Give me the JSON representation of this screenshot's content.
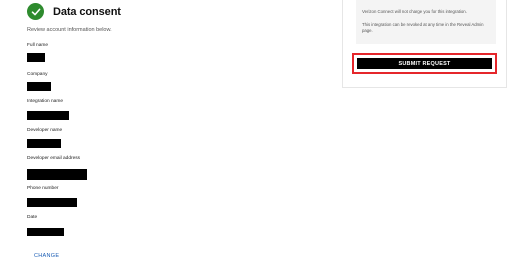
{
  "header": {
    "title": "Data consent",
    "check_icon": "check-circle-icon",
    "accent_color": "#2e8b2e"
  },
  "subtitle": "Review account information below.",
  "fields": [
    {
      "label": "Full name",
      "value_redacted": true
    },
    {
      "label": "Company",
      "value_redacted": true
    },
    {
      "label": "Integration name",
      "value_redacted": true
    },
    {
      "label": "Developer name",
      "value_redacted": true
    },
    {
      "label": "Developer email address",
      "value_redacted": true
    },
    {
      "label": "Phone number",
      "value_redacted": true
    },
    {
      "label": "Date",
      "value_redacted": true
    }
  ],
  "change_link": "CHANGE",
  "panel": {
    "notice_line_1": "Verizon Connect will not charge you for this integration.",
    "notice_line_2": "This integration can be revoked at any time in the Reveal Admin page.",
    "submit_label": "SUBMIT REQUEST",
    "highlight_color": "#e5262b"
  }
}
